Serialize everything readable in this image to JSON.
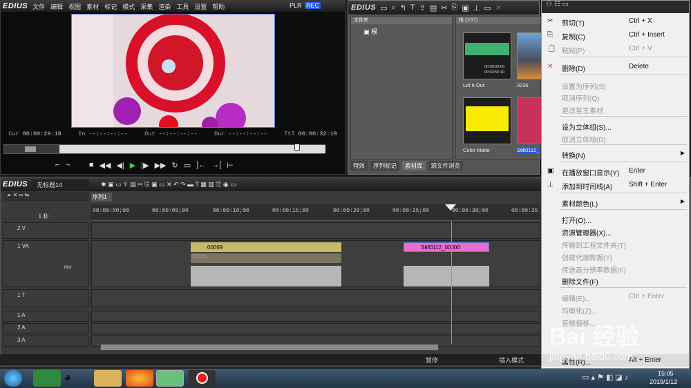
{
  "player": {
    "logo": "EDIUS",
    "menu": [
      "文件",
      "编辑",
      "视图",
      "素材",
      "标记",
      "模式",
      "采集",
      "渲染",
      "工具",
      "设置",
      "帮助"
    ],
    "plr": "PLR",
    "rec": "REC",
    "cur_label": "Cur",
    "cur": "00:00:29:18",
    "in_label": "In",
    "in": "--:--:--:--",
    "out_label": "Out",
    "out": "--:--:--:--",
    "dur_label": "Dur",
    "dur": "--:--:--:--",
    "ttl_label": "Ttl",
    "ttl": "00:00:32:19"
  },
  "bin": {
    "logo": "EDIUS",
    "folder_header": "文件夹",
    "root": "根",
    "asset_header": "根 (1/17)",
    "assets": [
      {
        "name": "Let It Out",
        "time": "00:00:00:00",
        "dur": "00:03:50:10"
      },
      {
        "name": "0236"
      },
      {
        "name": "Color Matte"
      },
      {
        "name": "Still0112_"
      }
    ],
    "tabs": [
      "特效",
      "序列标记",
      "素材库",
      "源文件浏览"
    ]
  },
  "timeline": {
    "logo": "EDIUS",
    "project": "无标题14",
    "sequence": "序列1",
    "scale": "1 秒",
    "ruler": [
      "00:00:00;00",
      "00:00:05;00",
      "00:00:10;00",
      "00:00:15;00",
      "00:00:20;00",
      "00:00:25;00",
      "00:00:30;00",
      "00:00:35"
    ],
    "tracks": [
      {
        "label": "2 V"
      },
      {
        "label": "1 VA"
      },
      {
        "label": "1 T"
      },
      {
        "label": "1 A"
      },
      {
        "label": "2 A"
      },
      {
        "label": "3 A"
      }
    ],
    "mix": "MIX",
    "clips": [
      {
        "name": "00069",
        "audio": "00069"
      },
      {
        "name": "Still0112_00000"
      }
    ],
    "status": {
      "pause": "暂停",
      "insert": "插入模式"
    }
  },
  "menu": [
    {
      "icon": "✂",
      "label": "剪切(T)",
      "shortcut": "Ctrl + X",
      "disabled": false
    },
    {
      "icon": "⎘",
      "label": "复制(C)",
      "shortcut": "Ctrl + Insert",
      "disabled": false
    },
    {
      "icon": "📋",
      "label": "粘贴(P)",
      "shortcut": "Ctrl + V",
      "disabled": true
    },
    {
      "icon": "✕",
      "label": "删除(D)",
      "shortcut": "Delete",
      "disabled": false
    },
    {
      "label": "设置为序列(S)",
      "disabled": true
    },
    {
      "label": "取消序列(Q)",
      "disabled": true
    },
    {
      "label": "更改至主素材",
      "disabled": true
    },
    {
      "label": "设为立体组(S)...",
      "disabled": false
    },
    {
      "label": "取消立体组(D)",
      "disabled": true
    },
    {
      "label": "转换(N)",
      "disabled": false,
      "sub": true
    },
    {
      "icon": "▣",
      "label": "在播放窗口显示(Y)",
      "shortcut": "Enter",
      "disabled": false
    },
    {
      "icon": "⊥",
      "label": "添加到时间线(A)",
      "shortcut": "Shift + Enter",
      "disabled": false
    },
    {
      "label": "素材颜色(L)",
      "disabled": false,
      "sub": true
    },
    {
      "label": "打开(O)...",
      "disabled": false
    },
    {
      "label": "资源管理器(X)...",
      "disabled": false
    },
    {
      "label": "传输到工程文件夹(T)",
      "disabled": true
    },
    {
      "label": "创建代理数据(Y)",
      "disabled": true
    },
    {
      "label": "传送高分辨率数据(F)",
      "disabled": true
    },
    {
      "label": "删除文件(F)",
      "disabled": false
    },
    {
      "label": "编辑(E)...",
      "shortcut": "Ctrl + Enter",
      "disabled": true
    },
    {
      "label": "均衡化(Z)...",
      "disabled": true
    },
    {
      "label": "音频偏移...",
      "disabled": true
    },
    {
      "label": "",
      "disabled": true
    },
    {
      "label": "属性(R)...",
      "shortcut": "Alt + Enter",
      "disabled": false
    }
  ],
  "taskbar": {
    "time": "15:05",
    "date": "2019/1/12"
  },
  "watermark": {
    "brand": "Bai 经验",
    "url": "jingyan.baidu.com"
  },
  "colors": {
    "accent": "#5d78d8",
    "clip_video": "#c8b96a",
    "clip_still": "#e66fd0",
    "playhead": "#4fb0d8"
  }
}
